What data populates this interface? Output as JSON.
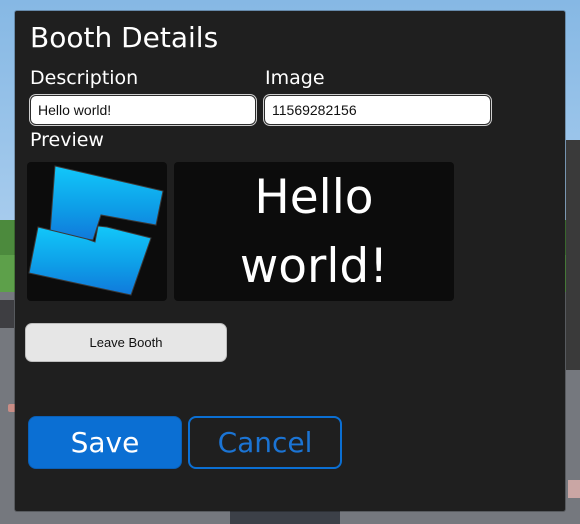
{
  "dialog": {
    "title": "Booth Details"
  },
  "description": {
    "label": "Description",
    "value": "Hello world!"
  },
  "image": {
    "label": "Image",
    "value": "11569282156"
  },
  "preview": {
    "label": "Preview",
    "icon": "roblox-logo-icon",
    "text": "Hello world!"
  },
  "actions": {
    "leave_label": "Leave Booth",
    "save_label": "Save",
    "cancel_label": "Cancel"
  },
  "colors": {
    "panel_background": "#1f1f1f",
    "preview_background": "#0c0c0c",
    "primary_blue": "#0b6fd3",
    "logo_light_blue": "#12c8fa",
    "logo_dark_blue": "#1079db"
  }
}
